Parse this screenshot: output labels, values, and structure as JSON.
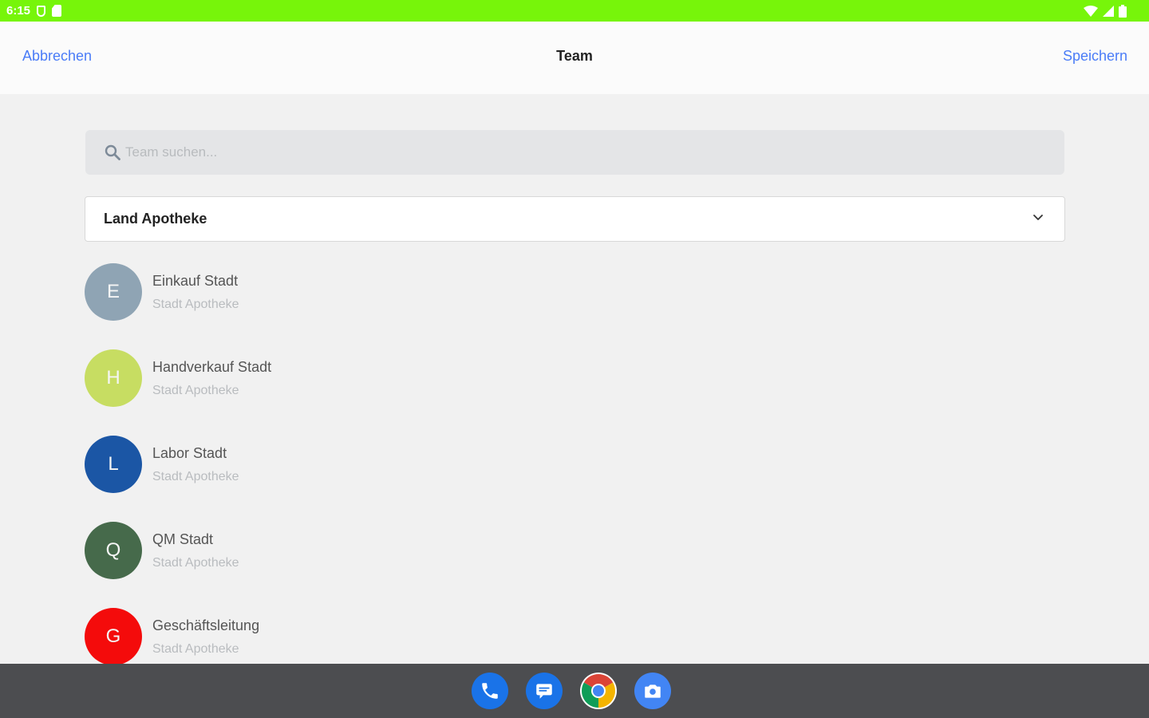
{
  "status_bar": {
    "time": "6:15"
  },
  "header": {
    "cancel": "Abbrechen",
    "title": "Team",
    "save": "Speichern"
  },
  "search": {
    "placeholder": "Team suchen..."
  },
  "dropdown": {
    "selected": "Land Apotheke"
  },
  "teams": [
    {
      "initial": "E",
      "name": "Einkauf Stadt",
      "pharmacy": "Stadt Apotheke",
      "color": "#8fa4b4"
    },
    {
      "initial": "H",
      "name": "Handverkauf Stadt",
      "pharmacy": "Stadt Apotheke",
      "color": "#c7dd62"
    },
    {
      "initial": "L",
      "name": "Labor Stadt",
      "pharmacy": "Stadt Apotheke",
      "color": "#1b56a5"
    },
    {
      "initial": "Q",
      "name": "QM Stadt",
      "pharmacy": "Stadt Apotheke",
      "color": "#466a4b"
    },
    {
      "initial": "G",
      "name": "Geschäftsleitung",
      "pharmacy": "Stadt Apotheke",
      "color": "#f40b0b"
    }
  ],
  "dock": [
    "phone-app",
    "messages-app",
    "chrome-app",
    "camera-app"
  ],
  "colors": {
    "status_bar": "#77f50a",
    "accent": "#4a7cf7",
    "nav_bar": "#4c4d50"
  }
}
